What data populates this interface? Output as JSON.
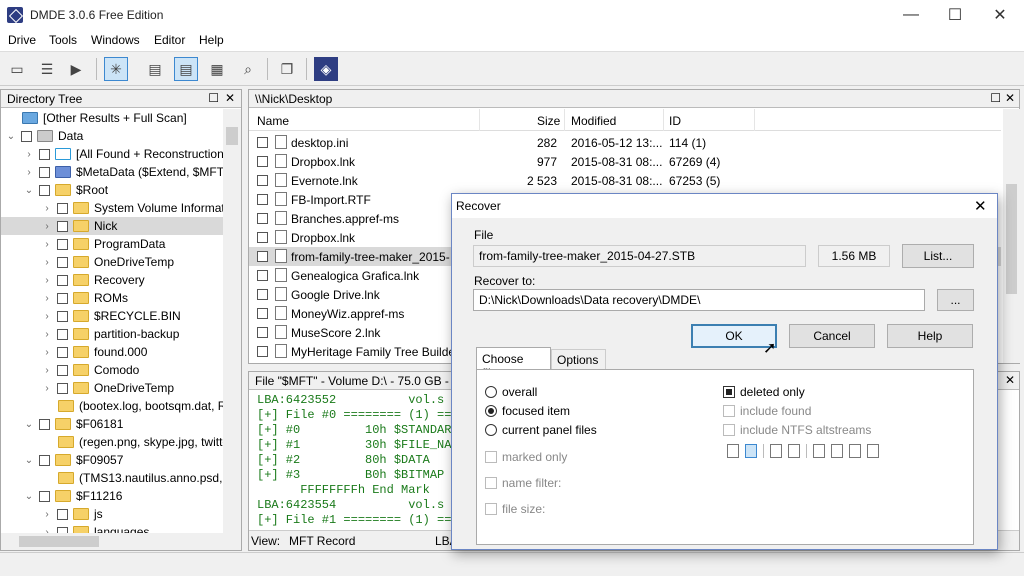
{
  "window": {
    "title": "DMDE 3.0.6 Free Edition",
    "minimize": "—",
    "maximize": "☐",
    "close": "✕"
  },
  "menu": [
    "Drive",
    "Tools",
    "Windows",
    "Editor",
    "Help"
  ],
  "dir_tree": {
    "title": "Directory Tree",
    "items": [
      {
        "label": "[Other Results + Full Scan]",
        "indent": 0
      },
      {
        "label": "Data",
        "indent": 0
      },
      {
        "label": "[All Found + Reconstruction]",
        "indent": 1
      },
      {
        "label": "$MetaData ($Extend, $MFT, $M",
        "indent": 1
      },
      {
        "label": "$Root",
        "indent": 1
      },
      {
        "label": "System Volume Information",
        "indent": 2
      },
      {
        "label": "Nick",
        "indent": 2
      },
      {
        "label": "ProgramData",
        "indent": 2
      },
      {
        "label": "OneDriveTemp",
        "indent": 2
      },
      {
        "label": "Recovery",
        "indent": 2
      },
      {
        "label": "ROMs",
        "indent": 2
      },
      {
        "label": "$RECYCLE.BIN",
        "indent": 2
      },
      {
        "label": "partition-backup",
        "indent": 2
      },
      {
        "label": "found.000",
        "indent": 2
      },
      {
        "label": "Comodo",
        "indent": 2
      },
      {
        "label": "OneDriveTemp",
        "indent": 2
      },
      {
        "label": "(bootex.log, bootsqm.dat, Rec",
        "indent": 2
      },
      {
        "label": "$F06181",
        "indent": 1
      },
      {
        "label": "(regen.png, skype.jpg, twitter-",
        "indent": 2
      },
      {
        "label": "$F09057",
        "indent": 1
      },
      {
        "label": "(TMS13.nautilus.anno.psd, TM",
        "indent": 2
      },
      {
        "label": "$F11216",
        "indent": 1
      },
      {
        "label": "js",
        "indent": 2
      },
      {
        "label": "languages",
        "indent": 2
      }
    ]
  },
  "file_list": {
    "path": "\\\\Nick\\Desktop",
    "columns": {
      "name": "Name",
      "size": "Size",
      "modified": "Modified",
      "id": "ID"
    },
    "rows": [
      {
        "name": "desktop.ini",
        "size": "282",
        "modified": "2016-05-12 13:...",
        "id": "114 (1)"
      },
      {
        "name": "Dropbox.lnk",
        "size": "977",
        "modified": "2015-08-31 08:...",
        "id": "67269 (4)"
      },
      {
        "name": "Evernote.lnk",
        "size": "2 523",
        "modified": "2015-08-31 08:...",
        "id": "67253 (5)"
      },
      {
        "name": "FB-Import.RTF",
        "size": "",
        "modified": "",
        "id": ""
      },
      {
        "name": "Branches.appref-ms",
        "size": "",
        "modified": "",
        "id": ""
      },
      {
        "name": "Dropbox.lnk",
        "size": "",
        "modified": "",
        "id": ""
      },
      {
        "name": "from-family-tree-maker_2015-",
        "size": "",
        "modified": "",
        "id": ""
      },
      {
        "name": "Genealogica Grafica.lnk",
        "size": "",
        "modified": "",
        "id": ""
      },
      {
        "name": "Google Drive.lnk",
        "size": "",
        "modified": "",
        "id": ""
      },
      {
        "name": "MoneyWiz.appref-ms",
        "size": "",
        "modified": "",
        "id": ""
      },
      {
        "name": "MuseScore 2.lnk",
        "size": "",
        "modified": "",
        "id": ""
      },
      {
        "name": "MyHeritage Family Tree Builde",
        "size": "",
        "modified": "",
        "id": ""
      }
    ]
  },
  "mft_panel": {
    "title": "File \"$MFT\" - Volume D:\\ - 75.0 GB - N",
    "lines": [
      "LBA:6423552          vol.s",
      "[+] File #0 ======== (1) ===",
      "[+] #0         10h $STANDAR",
      "[+] #1         30h $FILE_NA",
      "[+] #2         80h $DATA",
      "[+] #3         B0h $BITMAP",
      "      FFFFFFFFh End Mark",
      "",
      "LBA:6423554          vol.s",
      "[+] File #1 ======== (1) ==="
    ],
    "view_label": "View:",
    "view_value": "MFT Record",
    "lba_label": "LBA"
  },
  "dialog": {
    "title": "Recover",
    "file_label": "File",
    "file_value": "from-family-tree-maker_2015-04-27.STB",
    "size": "1.56 MB",
    "list_button": "List...",
    "recover_to_label": "Recover to:",
    "recover_to_value": "D:\\Nick\\Downloads\\Data recovery\\DMDE\\",
    "browse_button": "...",
    "ok": "OK",
    "cancel": "Cancel",
    "help": "Help",
    "tabs": [
      "Choose files",
      "Options"
    ],
    "radios": [
      "overall",
      "focused item",
      "current panel files"
    ],
    "left_checks": [
      "marked only",
      "name filter:",
      "file size:"
    ],
    "right_checks": [
      "deleted only",
      "include found",
      "include NTFS altstreams"
    ]
  }
}
